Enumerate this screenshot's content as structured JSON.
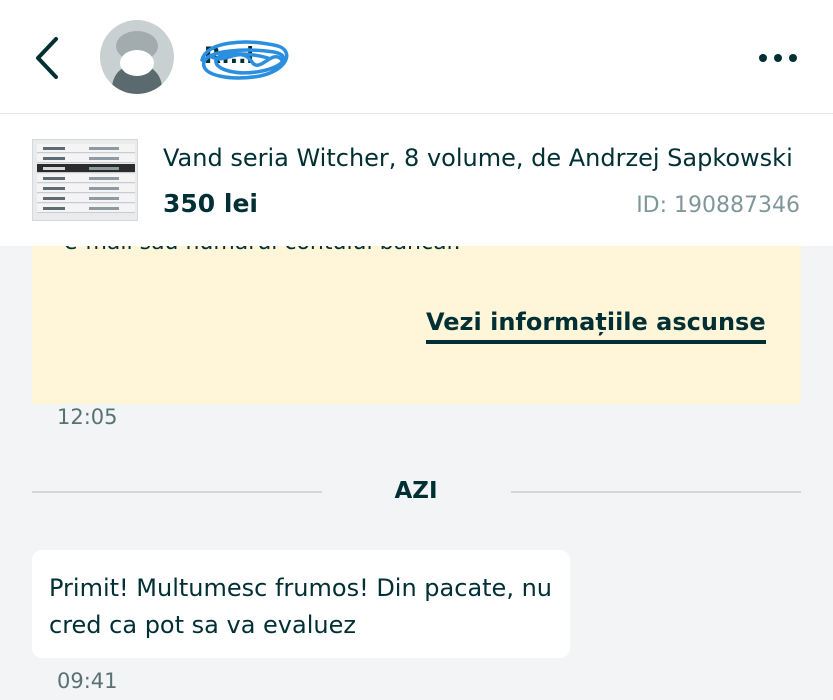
{
  "header": {
    "back_icon": "chevron-left-icon",
    "seller_name": "R...i",
    "more_icon": "more-horizontal-icon"
  },
  "listing": {
    "title": "Vand seria Witcher, 8 volume, de Andrzej Sapkowski",
    "price": "350 lei",
    "id": "ID: 190887346"
  },
  "messages": {
    "info_card": {
      "cut_text": "e-mail sau numărul contului bancar.",
      "reveal_label": "Vezi informațiile ascunse"
    },
    "time_1": "12:05",
    "day_divider": "AZI",
    "bubble_text": "Primit! Multumesc frumos! Din pacate, nu cred ca pot sa va evaluez",
    "time_2": "09:41"
  },
  "colors": {
    "primary": "#002f34",
    "background": "#f2f4f5",
    "info_card": "#fff6d9",
    "scribble": "#2b8fe0"
  }
}
